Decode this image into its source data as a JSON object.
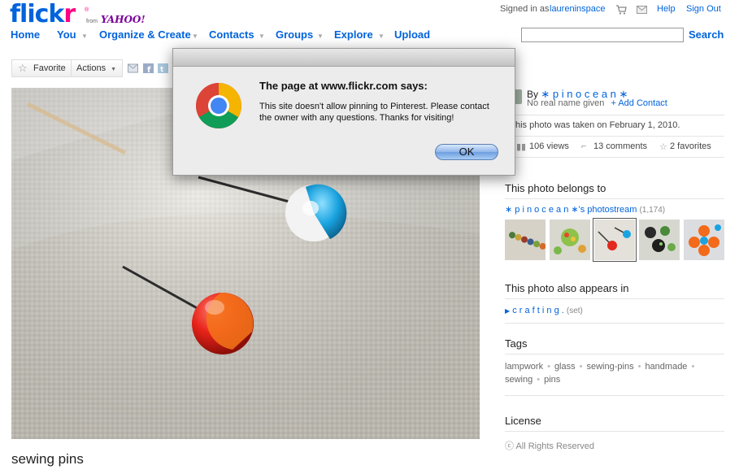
{
  "header": {
    "logo_main": "flickr",
    "logo_from": "from",
    "logo_yahoo": "YAHOO!",
    "signed_in_label": "Signed in as",
    "username": "laureninspace",
    "help": "Help",
    "sign_out": "Sign Out",
    "search_label": "Search",
    "search_value": ""
  },
  "nav": {
    "home": "Home",
    "you": "You",
    "organize": "Organize & Create",
    "contacts": "Contacts",
    "groups": "Groups",
    "explore": "Explore",
    "upload": "Upload"
  },
  "toolbar": {
    "favorite": "Favorite",
    "actions": "Actions"
  },
  "photo": {
    "title": "sewing pins"
  },
  "sidebar": {
    "by_label": "By",
    "owner": "∗ p i n o c e a n ∗",
    "no_real_name": "No real name given",
    "add_contact": "+ Add Contact",
    "taken_on": "his photo was taken on February 1, 2010.",
    "views": "106 views",
    "comments": "13 comments",
    "favorites": "2 favorites",
    "belongs_heading": "This photo belongs to",
    "photostream": "∗ p i n o c e a n ∗'s photostream",
    "photostream_count": "(1,174)",
    "appears_heading": "This photo also appears in",
    "set_name": "c r a f t i n g .",
    "set_tag": "(set)",
    "tags_heading": "Tags",
    "tags": [
      "lampwork",
      "glass",
      "sewing-pins",
      "handmade",
      "sewing",
      "pins"
    ],
    "license_heading": "License",
    "license": "All Rights Reserved"
  },
  "dialog": {
    "title": "The page at www.flickr.com says:",
    "message": "This site doesn't allow pinning to Pinterest. Please contact the owner with any questions. Thanks for visiting!",
    "ok": "OK"
  },
  "colors": {
    "flickr_blue": "#0063dc",
    "flickr_pink": "#ff0084",
    "yahoo_purple": "#7b0099"
  }
}
